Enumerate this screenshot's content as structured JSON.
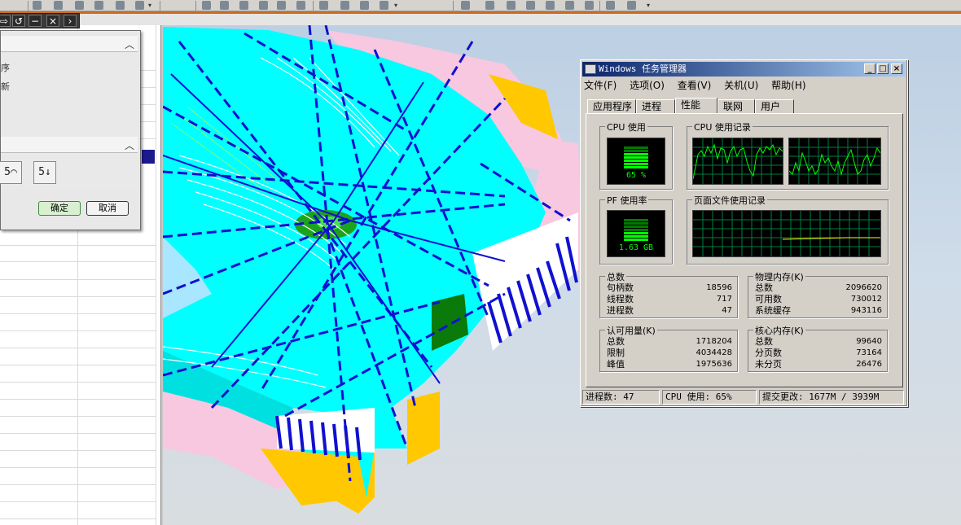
{
  "dialog": {
    "line1": "序",
    "line2": "新",
    "icon1": "5⌒",
    "icon2": "5↓",
    "ok_label": "确定",
    "cancel_label": "取消"
  },
  "command_strip": {
    "b1": "⇨",
    "b2": "↺",
    "b3": "−",
    "b4": "×",
    "b5": "›"
  },
  "task_manager": {
    "title": "Windows 任务管理器",
    "menu": [
      "文件(F)",
      "选项(O)",
      "查看(V)",
      "关机(U)",
      "帮助(H)"
    ],
    "tabs": [
      "应用程序",
      "进程",
      "性能",
      "联网",
      "用户"
    ],
    "active_tab": "性能",
    "cpu_usage_label": "CPU 使用",
    "cpu_usage_value": "65 %",
    "cpu_usage_percent": 65,
    "cpu_history_label": "CPU 使用记录",
    "pf_label": "PF 使用率",
    "pf_value": "1.63 GB",
    "pf_history_label": "页面文件使用记录",
    "totals": {
      "title": "总数",
      "rows": [
        {
          "k": "句柄数",
          "v": "18596"
        },
        {
          "k": "线程数",
          "v": "717"
        },
        {
          "k": "进程数",
          "v": "47"
        }
      ]
    },
    "physical": {
      "title": "物理内存(K)",
      "rows": [
        {
          "k": "总数",
          "v": "2096620"
        },
        {
          "k": "可用数",
          "v": "730012"
        },
        {
          "k": "系统缓存",
          "v": "943116"
        }
      ]
    },
    "commit": {
      "title": "认可用量(K)",
      "rows": [
        {
          "k": "总数",
          "v": "1718204"
        },
        {
          "k": "限制",
          "v": "4034428"
        },
        {
          "k": "峰值",
          "v": "1975636"
        }
      ]
    },
    "kernel": {
      "title": "核心内存(K)",
      "rows": [
        {
          "k": "总数",
          "v": "99640"
        },
        {
          "k": "分页数",
          "v": "73164"
        },
        {
          "k": "未分页",
          "v": "26476"
        }
      ]
    },
    "status": {
      "processes": "进程数: 47",
      "cpu": "CPU 使用: 65%",
      "commit": "提交更改: 1677M / 3939M"
    }
  },
  "colors": {
    "orange_accent": "#d26a1a",
    "title_bar": "#0a246a",
    "mesh_cyan": "#00ffff",
    "mesh_blue": "#1010d0",
    "mesh_yellow": "#ffc800",
    "graph_green": "#00ff00"
  }
}
